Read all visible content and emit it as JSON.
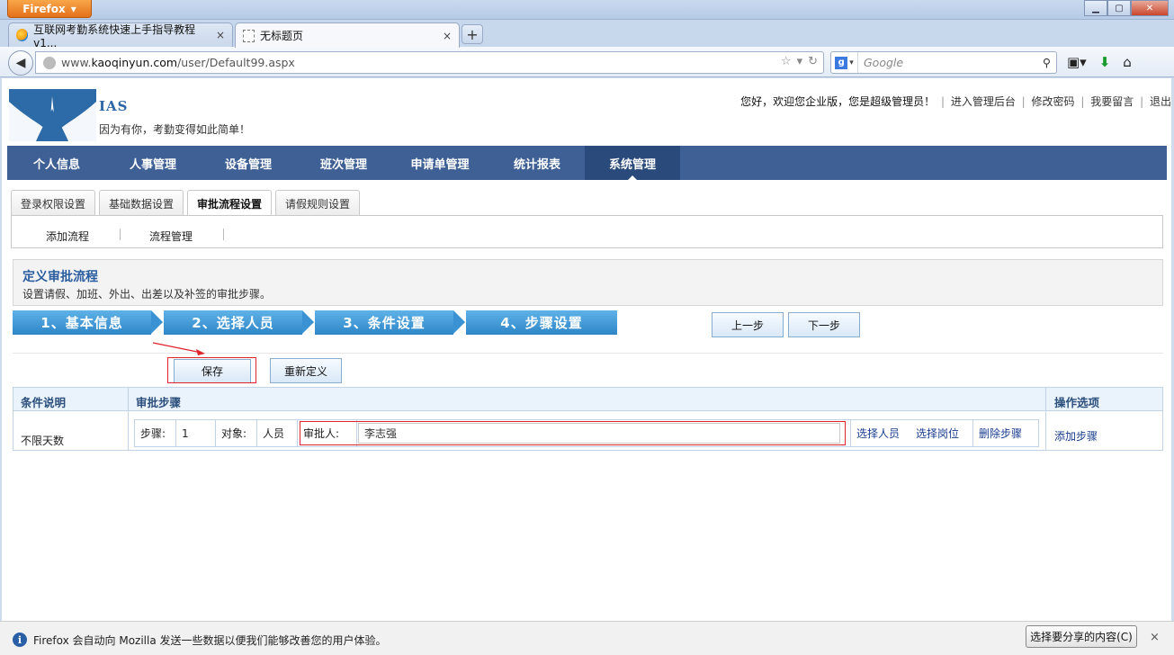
{
  "browser": {
    "app_button": "Firefox",
    "tabs": [
      {
        "label": "互联网考勤系统快速上手指导教程 v1...",
        "close": "×"
      },
      {
        "label": "无标题页",
        "close": "×"
      }
    ],
    "new_tab": "+",
    "url": {
      "prefix": "www.",
      "domain": "kaoqinyun.com",
      "path": "/user/Default99.aspx"
    },
    "search_placeholder": "Google"
  },
  "header": {
    "brand": "IAS",
    "slogan": "因为有你，考勤变得如此简单！",
    "welcome": "您好，欢迎您企业版，您是超级管理员！",
    "links": [
      "进入管理后台",
      "修改密码",
      "我要留言",
      "退出"
    ],
    "separator": "|"
  },
  "main_nav": [
    {
      "label": "个人信息",
      "active": false
    },
    {
      "label": "人事管理",
      "active": false
    },
    {
      "label": "设备管理",
      "active": false
    },
    {
      "label": "班次管理",
      "active": false
    },
    {
      "label": "申请单管理",
      "active": false
    },
    {
      "label": "统计报表",
      "active": false
    },
    {
      "label": "系统管理",
      "active": true
    }
  ],
  "sub_tabs": [
    {
      "label": "登录权限设置",
      "active": false
    },
    {
      "label": "基础数据设置",
      "active": false
    },
    {
      "label": "审批流程设置",
      "active": true
    },
    {
      "label": "请假规则设置",
      "active": false
    }
  ],
  "sub_links": [
    "添加流程",
    "流程管理"
  ],
  "info": {
    "title": "定义审批流程",
    "desc": "设置请假、加班、外出、出差以及补签的审批步骤。"
  },
  "wizard_steps": [
    "1、基本信息",
    "2、选择人员",
    "3、条件设置",
    "4、步骤设置"
  ],
  "wizard_buttons": {
    "prev": "上一步",
    "next": "下一步"
  },
  "actions": {
    "save": "保存",
    "redefine": "重新定义"
  },
  "grid": {
    "headers": {
      "condition": "条件说明",
      "steps": "审批步骤",
      "ops": "操作选项"
    },
    "row": {
      "condition": "不限天数",
      "step_label": "步骤:",
      "step_value": "1",
      "target_label": "对象:",
      "target_value": "人员",
      "approver_label": "审批人:",
      "approver_value": "李志强",
      "select_person": "选择人员",
      "select_position": "选择岗位",
      "delete_step": "删除步骤"
    },
    "add_step": "添加步骤"
  },
  "notification": {
    "message": "Firefox 会自动向 Mozilla 发送一些数据以便我们能够改善您的用户体验。",
    "share_button": "选择要分享的内容(C)",
    "close": "×"
  },
  "colors": {
    "nav_bg": "#3e6095",
    "nav_active": "#2a4a7c",
    "wizard_step": "#3a92d2",
    "highlight_red": "#e0242c",
    "link_blue": "#1a3d8f"
  }
}
